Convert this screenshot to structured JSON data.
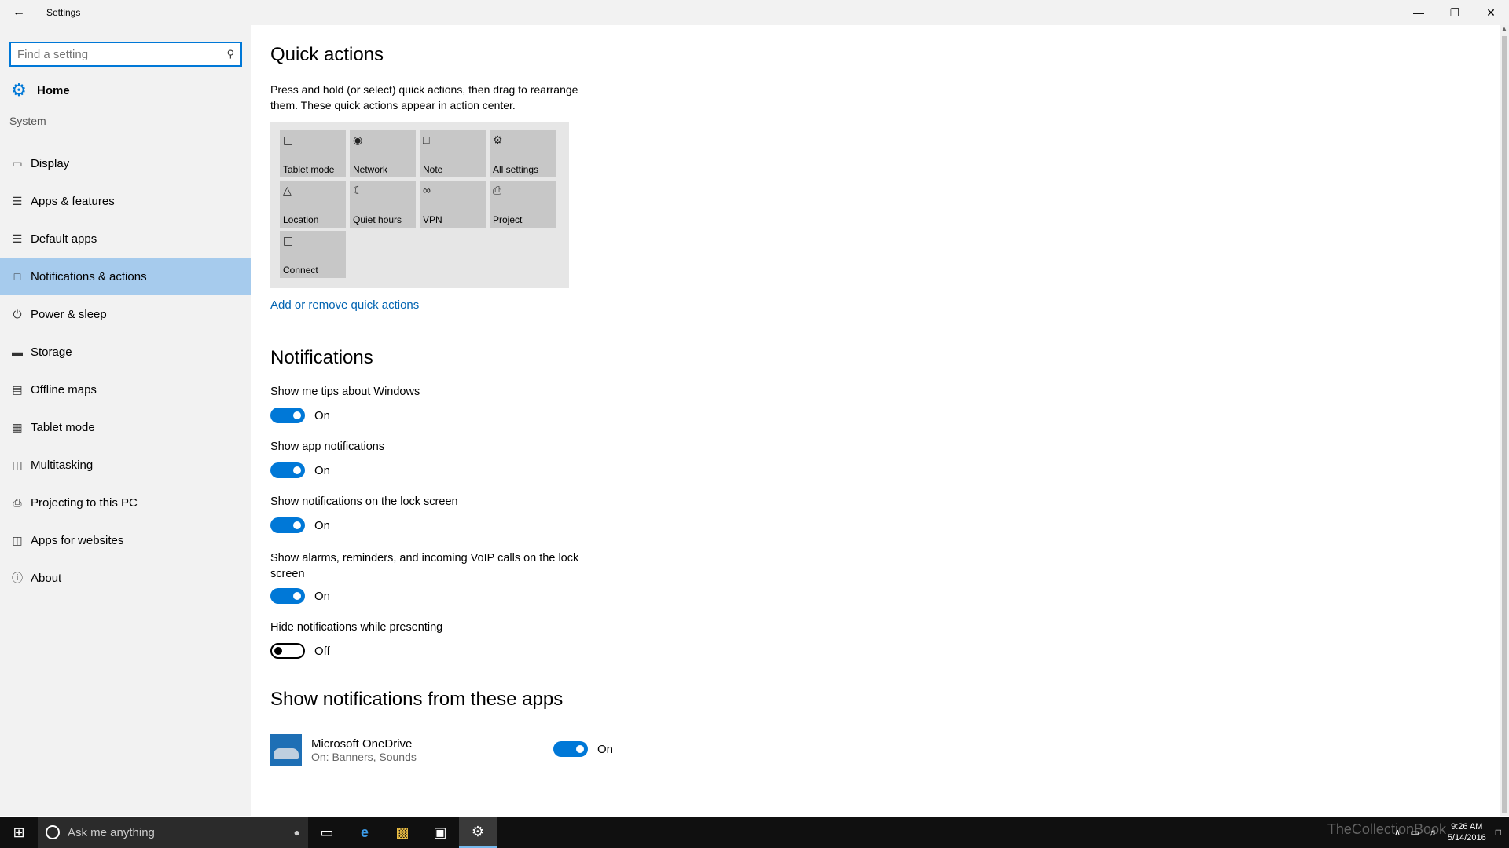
{
  "window": {
    "title": "Settings",
    "back_icon": "back-arrow-icon",
    "controls": [
      "minimize",
      "restore",
      "close"
    ]
  },
  "sidebar": {
    "search": {
      "placeholder": "Find a setting",
      "icon": "search-icon"
    },
    "home": {
      "label": "Home",
      "icon": "gear-icon"
    },
    "section": "System",
    "items": [
      {
        "label": "Display",
        "icon": "display-icon"
      },
      {
        "label": "Apps & features",
        "icon": "list-icon"
      },
      {
        "label": "Default apps",
        "icon": "default-apps-icon"
      },
      {
        "label": "Notifications & actions",
        "icon": "notification-icon",
        "active": true
      },
      {
        "label": "Power & sleep",
        "icon": "power-icon"
      },
      {
        "label": "Storage",
        "icon": "storage-icon"
      },
      {
        "label": "Offline maps",
        "icon": "map-icon"
      },
      {
        "label": "Tablet mode",
        "icon": "tablet-icon"
      },
      {
        "label": "Multitasking",
        "icon": "multitasking-icon"
      },
      {
        "label": "Projecting to this PC",
        "icon": "project-icon"
      },
      {
        "label": "Apps for websites",
        "icon": "apps-websites-icon"
      },
      {
        "label": "About",
        "icon": "info-icon"
      }
    ]
  },
  "quick_actions": {
    "title": "Quick actions",
    "description": "Press and hold (or select) quick actions, then drag to rearrange them. These quick actions appear in action center.",
    "tiles": [
      {
        "label": "Tablet mode",
        "icon": "tablet-mode-icon"
      },
      {
        "label": "Network",
        "icon": "globe-icon"
      },
      {
        "label": "Note",
        "icon": "note-icon"
      },
      {
        "label": "All settings",
        "icon": "gear-icon"
      },
      {
        "label": "Location",
        "icon": "location-icon"
      },
      {
        "label": "Quiet hours",
        "icon": "moon-icon"
      },
      {
        "label": "VPN",
        "icon": "vpn-icon"
      },
      {
        "label": "Project",
        "icon": "project-icon"
      },
      {
        "label": "Connect",
        "icon": "connect-icon"
      }
    ],
    "link": "Add or remove quick actions"
  },
  "notifications": {
    "title": "Notifications",
    "settings": [
      {
        "label": "Show me tips about Windows",
        "state": "On"
      },
      {
        "label": "Show app notifications",
        "state": "On"
      },
      {
        "label": "Show notifications on the lock screen",
        "state": "On"
      },
      {
        "label": "Show alarms, reminders, and incoming VoIP calls on the lock screen",
        "state": "On"
      },
      {
        "label": "Hide notifications while presenting",
        "state": "Off"
      }
    ]
  },
  "apps_section": {
    "title": "Show notifications from these apps",
    "apps": [
      {
        "name": "Microsoft OneDrive",
        "sub": "On: Banners, Sounds",
        "state": "On",
        "icon": "onedrive-icon"
      }
    ]
  },
  "taskbar": {
    "search_placeholder": "Ask me anything",
    "clock_time": "9:26 AM",
    "clock_date": "5/14/2016",
    "watermark": "TheCollectionBook"
  },
  "colors": {
    "accent": "#0078d7",
    "sidebar_bg": "#f2f2f2",
    "active_item": "#a6cbed",
    "link": "#0063b1"
  }
}
